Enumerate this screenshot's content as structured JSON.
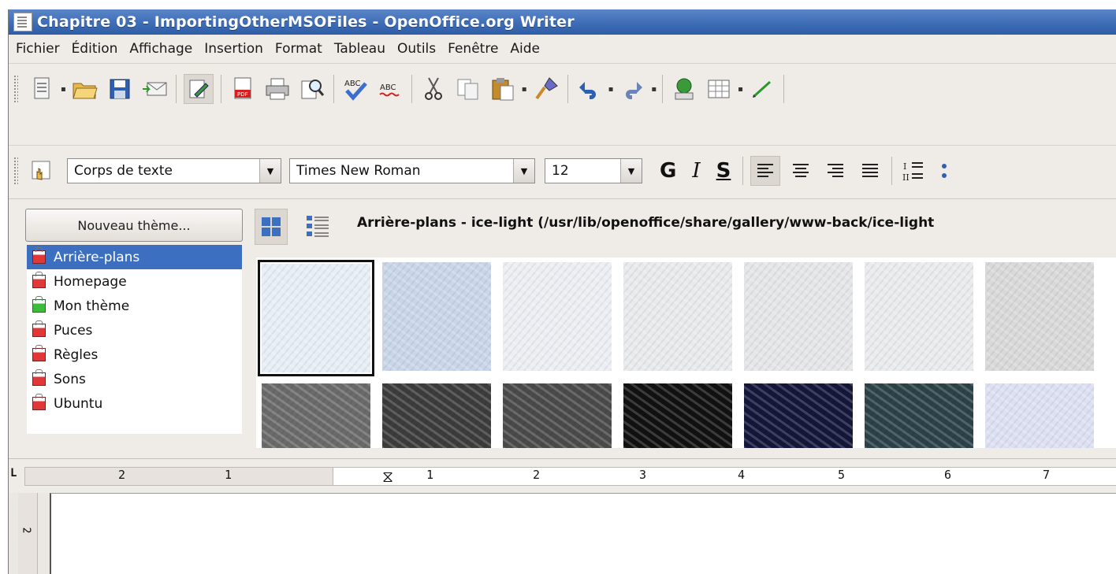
{
  "window": {
    "title": "Chapitre 03 - ImportingOtherMSOFiles - OpenOffice.org Writer"
  },
  "menu": [
    "Fichier",
    "Édition",
    "Affichage",
    "Insertion",
    "Format",
    "Tableau",
    "Outils",
    "Fenêtre",
    "Aide"
  ],
  "toolbar_std": {
    "icons": [
      "new-icon",
      "open-folder-icon",
      "save-icon",
      "email-icon",
      "edit-mode-icon",
      "export-pdf-icon",
      "print-icon",
      "page-preview-icon",
      "spellcheck-icon",
      "autospellcheck-icon",
      "cut-icon",
      "copy-icon",
      "paste-icon",
      "clone-formatting-icon",
      "undo-icon",
      "redo-icon",
      "navigator-icon",
      "table-icon",
      "draw-functions-icon"
    ]
  },
  "toolbar_fmt": {
    "style": "Corps de texte",
    "font": "Times New Roman",
    "size": "12",
    "bold": "G",
    "italic": "I",
    "shadow": "S"
  },
  "gallery": {
    "new_theme_label": "Nouveau thème...",
    "title": "Arrière-plans - ice-light (/usr/lib/openoffice/share/gallery/www-back/ice-light",
    "themes": [
      {
        "label": "Arrière-plans",
        "selected": true
      },
      {
        "label": "Homepage",
        "selected": false
      },
      {
        "label": "Mon thème",
        "selected": false
      },
      {
        "label": "Puces",
        "selected": false
      },
      {
        "label": "Règles",
        "selected": false
      },
      {
        "label": "Sons",
        "selected": false
      },
      {
        "label": "Ubuntu",
        "selected": false
      }
    ],
    "thumb_row1_colors": [
      "#e8eef6",
      "#c9d6ea",
      "#eceef3",
      "#e9eaec",
      "#e5e6e8",
      "#eaebed",
      "#d9d9d9"
    ],
    "thumb_row2_colors": [
      "#6a6a6a",
      "#3c3c3c",
      "#4a4a4a",
      "#111111",
      "#14163a",
      "#2a4248",
      "#dde0f2"
    ]
  },
  "ruler": {
    "left_numbers": [
      "2",
      "1"
    ],
    "right_numbers": [
      "1",
      "2",
      "3",
      "4",
      "5",
      "6",
      "7"
    ],
    "corner": "L"
  },
  "vruler": {
    "number": "2"
  }
}
